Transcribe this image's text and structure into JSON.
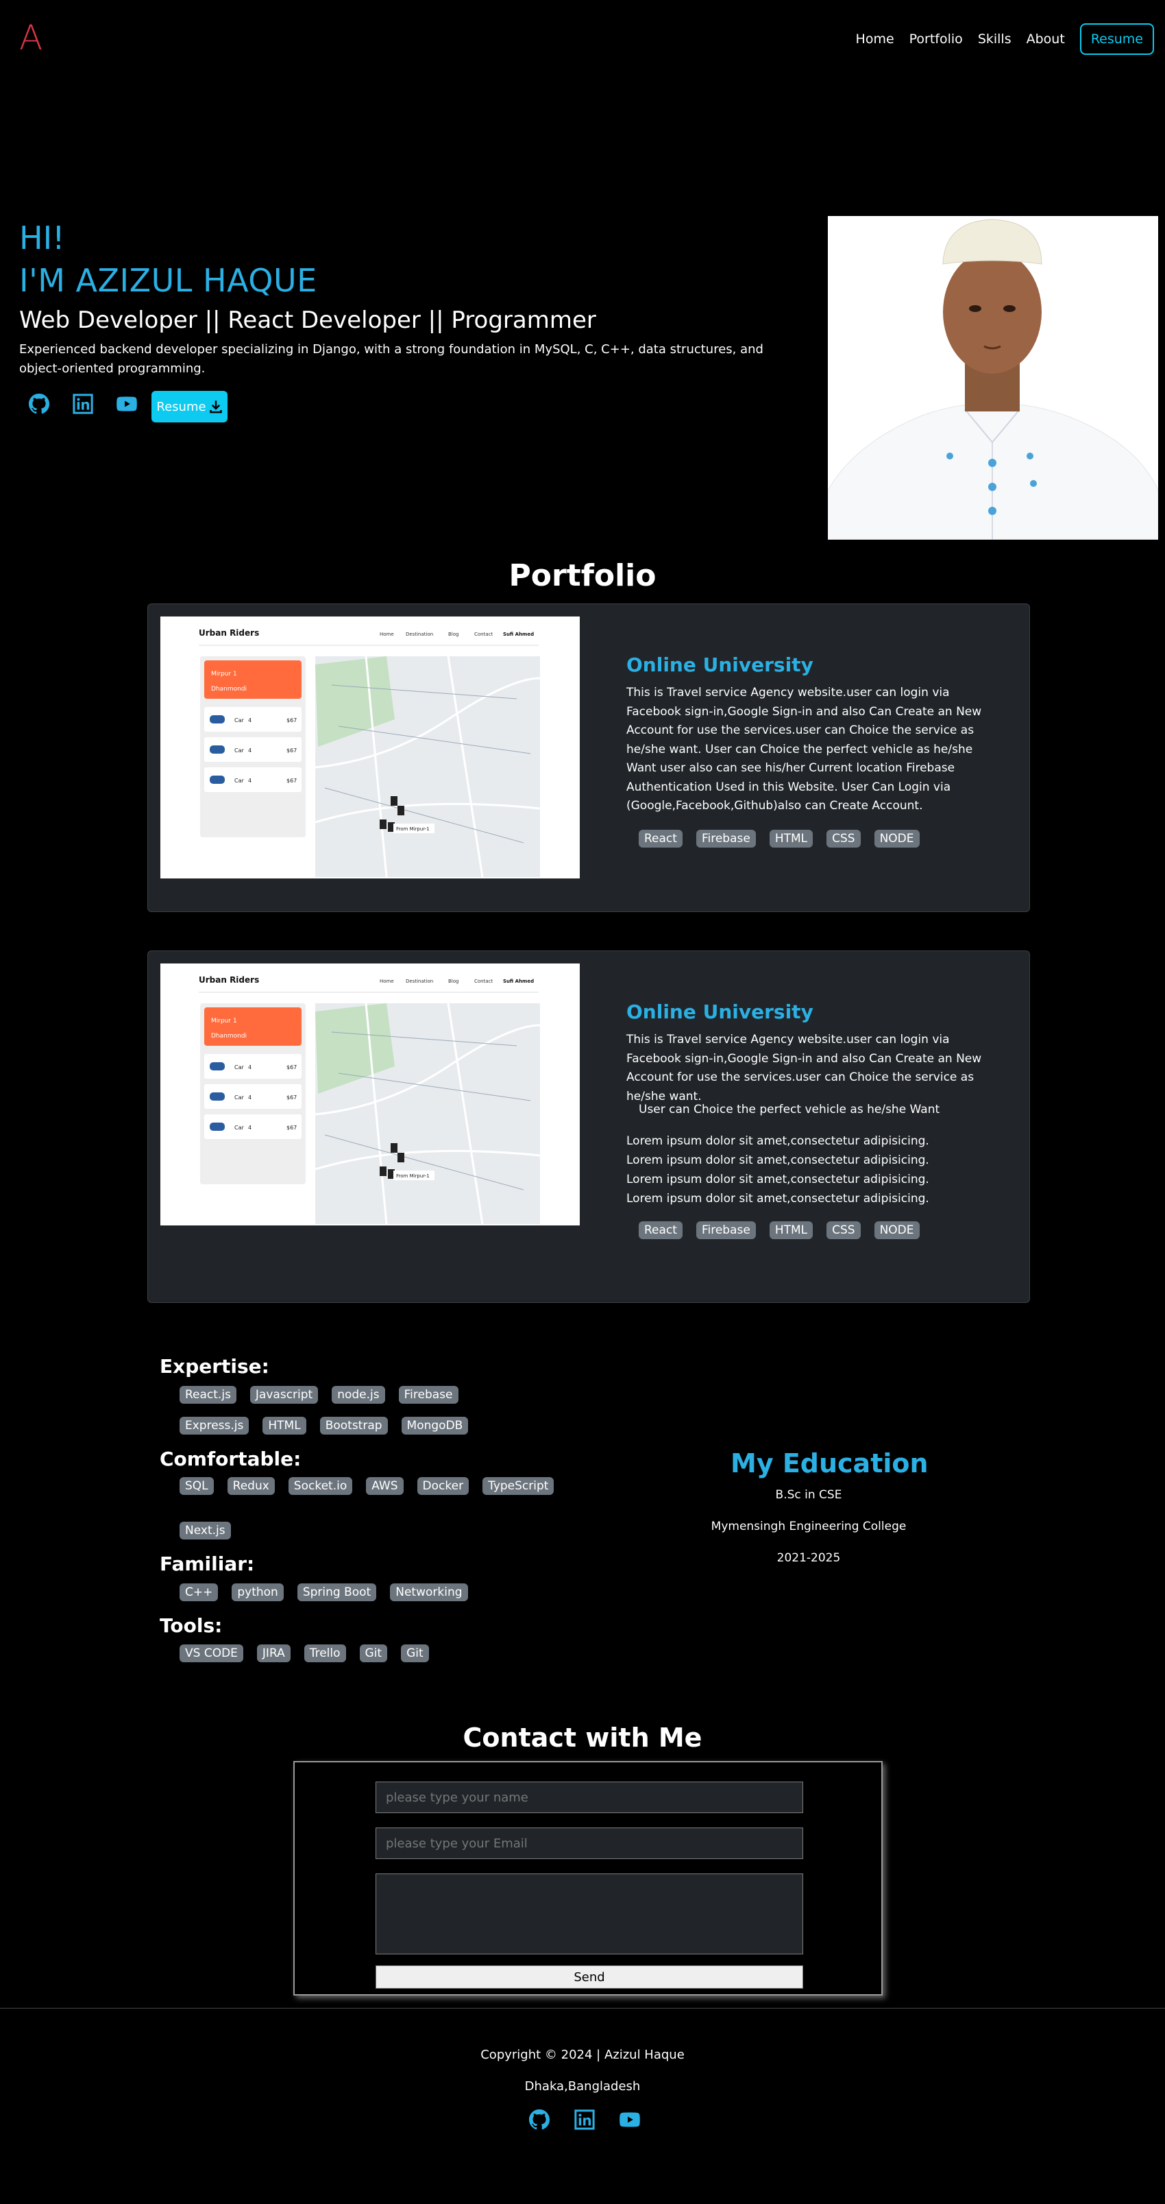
{
  "brand": {
    "logo": "A",
    "logo_color": "#dc3545",
    "accent": "#2bb0e4"
  },
  "nav": {
    "items": [
      "Home",
      "Portfolio",
      "Skills",
      "About"
    ],
    "resume": "Resume"
  },
  "hero": {
    "greeting": "HI!",
    "name": "I'M AZIZUL HAQUE",
    "role": "Web Developer || React Developer || Programmer",
    "description": "Experienced backend developer specializing in Django, with a strong foundation in MySQL, C, C++, data structures, and object-oriented programming.",
    "social": [
      "github-icon",
      "linkedin-icon",
      "youtube-icon"
    ],
    "resume_button": "Resume"
  },
  "portfolio": {
    "title": "Portfolio",
    "screenshot": {
      "brand": "Urban Riders",
      "nav": [
        "Home",
        "Destination",
        "Blog",
        "Contact",
        "Sufi Ahmed"
      ],
      "from": "Mirpur 1",
      "to": "Dhanmondi",
      "rows": [
        {
          "name": "Car",
          "cap": "4",
          "price": "$67"
        },
        {
          "name": "Car",
          "cap": "4",
          "price": "$67"
        },
        {
          "name": "Car",
          "cap": "4",
          "price": "$67"
        }
      ],
      "map_label": "From Mirpur-1"
    },
    "projects": [
      {
        "title": "Online University",
        "description": "This is Travel service Agency website.user can login via Facebook sign-in,Google Sign-in and also Can Create an New Account for use the services.user can Choice the service as he/she want. User can Choice the perfect vehicle as he/she Want user also can see his/her Current location Firebase Authentication Used in this Website. User Can Login via (Google,Facebook,Github)also can Create Account.",
        "tags": [
          "React",
          "Firebase",
          "HTML",
          "CSS",
          "NODE"
        ]
      },
      {
        "title": "Online University",
        "description": "This is Travel service Agency website.user can login via Facebook sign-in,Google Sign-in and also Can Create an New Account for use the services.user can Choice the service as he/she want.",
        "bullet": "User can Choice the perfect vehicle as he/she Want",
        "lorem": [
          "Lorem ipsum dolor sit amet,consectetur adipisicing.",
          "Lorem ipsum dolor sit amet,consectetur adipisicing.",
          "Lorem ipsum dolor sit amet,consectetur adipisicing.",
          "Lorem ipsum dolor sit amet,consectetur adipisicing."
        ],
        "tags": [
          "React",
          "Firebase",
          "HTML",
          "CSS",
          "NODE"
        ]
      }
    ]
  },
  "skills": {
    "expertise": {
      "label": "Expertise:",
      "row1": [
        "React.js",
        "Javascript",
        "node.js",
        "Firebase"
      ],
      "row2": [
        "Express.js",
        "HTML",
        "Bootstrap",
        "MongoDB"
      ]
    },
    "comfortable": {
      "label": "Comfortable:",
      "row1": [
        "SQL",
        "Redux",
        "Socket.io",
        "AWS",
        "Docker",
        "TypeScript"
      ],
      "row2": [
        "Next.js"
      ]
    },
    "familiar": {
      "label": "Familiar:",
      "items": [
        "C++",
        "python",
        "Spring Boot",
        "Networking"
      ]
    },
    "tools": {
      "label": "Tools:",
      "items": [
        "VS CODE",
        "JIRA",
        "Trello",
        "Git",
        "Git"
      ]
    }
  },
  "education": {
    "title": "My Education",
    "degree": "B.Sc in CSE",
    "school": "Mymensingh Engineering College",
    "years": "2021-2025"
  },
  "contact": {
    "title": "Contact with Me",
    "name_placeholder": "please type your name",
    "email_placeholder": "please type your Email",
    "send": "Send"
  },
  "footer": {
    "copyright": "Copyright © 2024 | Azizul Haque",
    "location": "Dhaka,Bangladesh"
  }
}
